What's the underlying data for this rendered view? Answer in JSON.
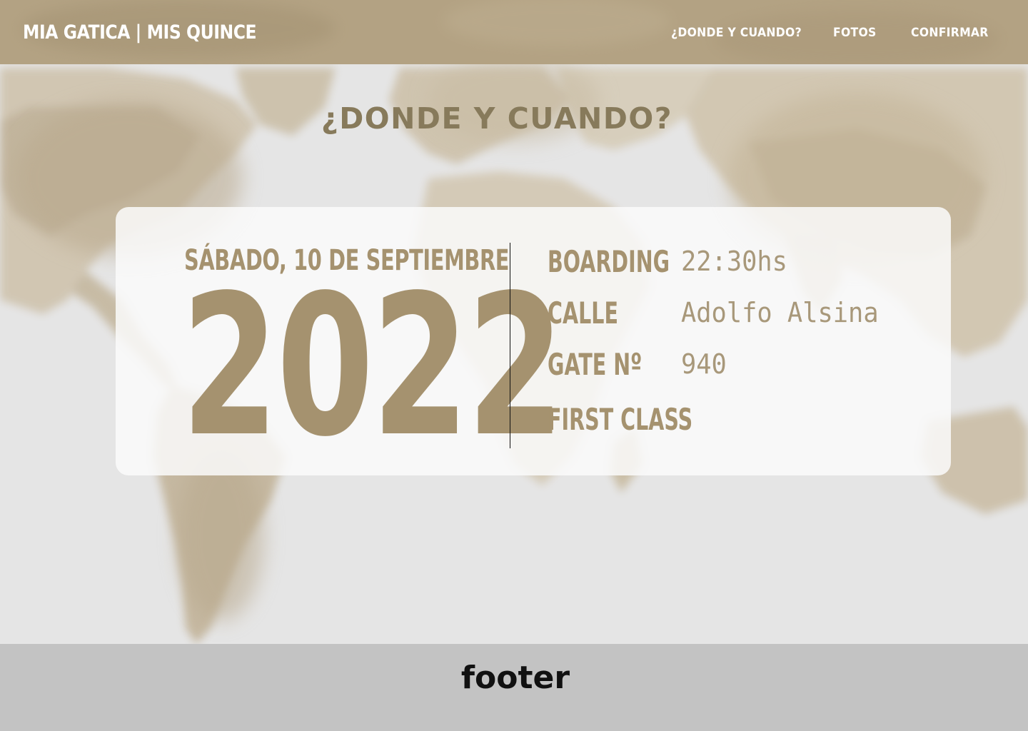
{
  "colors": {
    "nav_bg": "#b3a283",
    "accent": "#a5926f",
    "title": "#877a5b",
    "footer_bg": "#c3c3c3"
  },
  "header": {
    "brand": "MIA GATICA | MIS QUINCE",
    "nav": [
      {
        "label": "¿DONDE Y CUANDO?"
      },
      {
        "label": "FOTOS"
      },
      {
        "label": "CONFIRMAR"
      }
    ]
  },
  "section": {
    "title": "¿DONDE Y CUANDO?"
  },
  "ticket": {
    "date": "SÁBADO, 10 DE SEPTIEMBRE",
    "year": "2022",
    "rows": [
      {
        "label": "BOARDING",
        "value": "22:30hs"
      },
      {
        "label": "CALLE",
        "value": "Adolfo Alsina"
      },
      {
        "label": "GATE Nº",
        "value": "940"
      },
      {
        "label": "FIRST CLASS",
        "value": ""
      }
    ]
  },
  "footer": {
    "text": "footer"
  },
  "background": {
    "image": "world-map-watercolor"
  }
}
